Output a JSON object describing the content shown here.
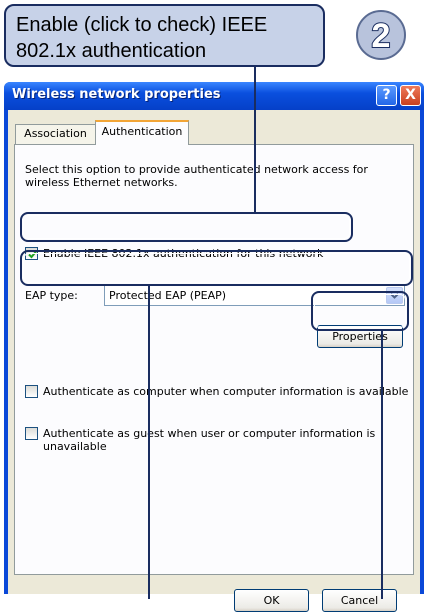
{
  "callout": {
    "text_line1": "Enable (click to check) IEEE",
    "text_line2": "802.1x authentication"
  },
  "step_badge": {
    "number": "2"
  },
  "window": {
    "title": "Wireless network properties",
    "help_glyph": "?",
    "close_glyph": "X"
  },
  "tabs": [
    {
      "label": "Association",
      "active": false
    },
    {
      "label": "Authentication",
      "active": true
    }
  ],
  "description": {
    "line1": "Select this option to provide authenticated network access for",
    "line2": "wireless Ethernet networks."
  },
  "enable_8021x": {
    "label": "Enable IEEE 802.1x authentication for this network",
    "checked": true
  },
  "eap_type": {
    "label": "EAP type:",
    "value": "Protected EAP (PEAP)"
  },
  "properties_button": {
    "label": "Properties"
  },
  "auth_computer": {
    "label": "Authenticate as computer when computer information is available",
    "checked": false
  },
  "auth_guest": {
    "line1": "Authenticate as guest when user or computer information is",
    "line2": "unavailable",
    "checked": false
  },
  "ok_button": {
    "label": "OK"
  },
  "cancel_button": {
    "label": "Cancel"
  },
  "colors": {
    "callout_fill": "#c7d2e8",
    "callout_border": "#1a2d60",
    "titlebar_blue": "#0a4fde",
    "dialog_face": "#ece9d8",
    "active_tab_accent": "#f2a536"
  }
}
